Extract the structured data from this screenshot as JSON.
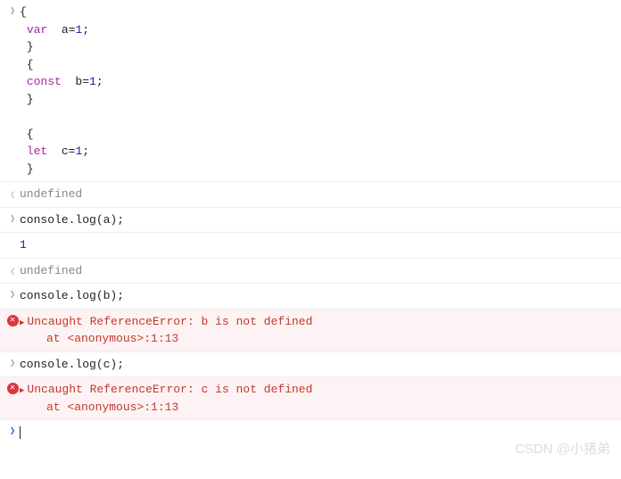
{
  "entries": [
    {
      "type": "input-code",
      "tokens": [
        {
          "t": "{",
          "c": ""
        },
        {
          "br": 1
        },
        {
          "t": " ",
          "c": ""
        },
        {
          "t": "var",
          "c": "kw"
        },
        {
          "t": "  a=",
          "c": ""
        },
        {
          "t": "1",
          "c": "num"
        },
        {
          "t": ";",
          "c": ""
        },
        {
          "br": 1
        },
        {
          "t": " }",
          "c": ""
        },
        {
          "br": 1
        },
        {
          "t": " {",
          "c": ""
        },
        {
          "br": 1
        },
        {
          "t": " ",
          "c": ""
        },
        {
          "t": "const",
          "c": "kw"
        },
        {
          "t": "  b=",
          "c": ""
        },
        {
          "t": "1",
          "c": "num"
        },
        {
          "t": ";",
          "c": ""
        },
        {
          "br": 1
        },
        {
          "t": " }",
          "c": ""
        },
        {
          "br": 1
        },
        {
          "br": 1
        },
        {
          "t": " {",
          "c": ""
        },
        {
          "br": 1
        },
        {
          "t": " ",
          "c": ""
        },
        {
          "t": "let",
          "c": "kw"
        },
        {
          "t": "  c=",
          "c": ""
        },
        {
          "t": "1",
          "c": "num"
        },
        {
          "t": ";",
          "c": ""
        },
        {
          "br": 1
        },
        {
          "t": " }",
          "c": ""
        }
      ]
    },
    {
      "type": "output-undefined",
      "text": "undefined"
    },
    {
      "type": "input-line",
      "text": "console.log(a);"
    },
    {
      "type": "log-num",
      "text": "1"
    },
    {
      "type": "output-undefined",
      "text": "undefined"
    },
    {
      "type": "input-line",
      "text": "console.log(b);"
    },
    {
      "type": "error",
      "line1": "Uncaught ReferenceError: b is not defined",
      "line2": "at <anonymous>:1:13"
    },
    {
      "type": "input-line",
      "text": "console.log(c);"
    },
    {
      "type": "error",
      "line1": "Uncaught ReferenceError: c is not defined",
      "line2": "at <anonymous>:1:13"
    },
    {
      "type": "prompt"
    }
  ],
  "watermark": "CSDN @小猪弟"
}
